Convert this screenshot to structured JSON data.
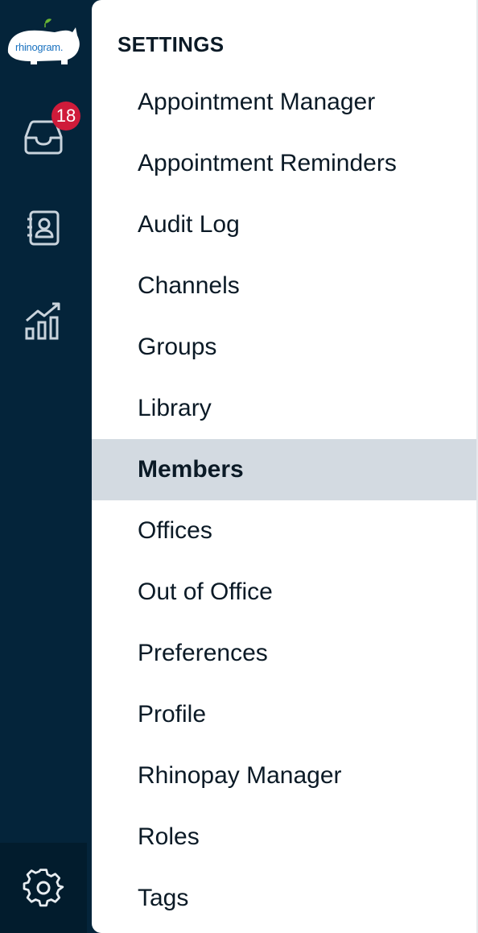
{
  "brand": {
    "logo_text": "rhinogram.",
    "accent_color": "#1a72c0",
    "leaf_color": "#6ab534"
  },
  "rail": {
    "background": "#04243a",
    "items": [
      {
        "icon": "inbox-icon",
        "badge": "18"
      },
      {
        "icon": "contacts-icon"
      },
      {
        "icon": "analytics-icon"
      }
    ],
    "settings_icon": "gear-icon"
  },
  "settings": {
    "title": "SETTINGS",
    "active": "Members",
    "items": [
      "Appointment Manager",
      "Appointment Reminders",
      "Audit Log",
      "Channels",
      "Groups",
      "Library",
      "Members",
      "Offices",
      "Out of Office",
      "Preferences",
      "Profile",
      "Rhinopay Manager",
      "Roles",
      "Tags"
    ]
  }
}
